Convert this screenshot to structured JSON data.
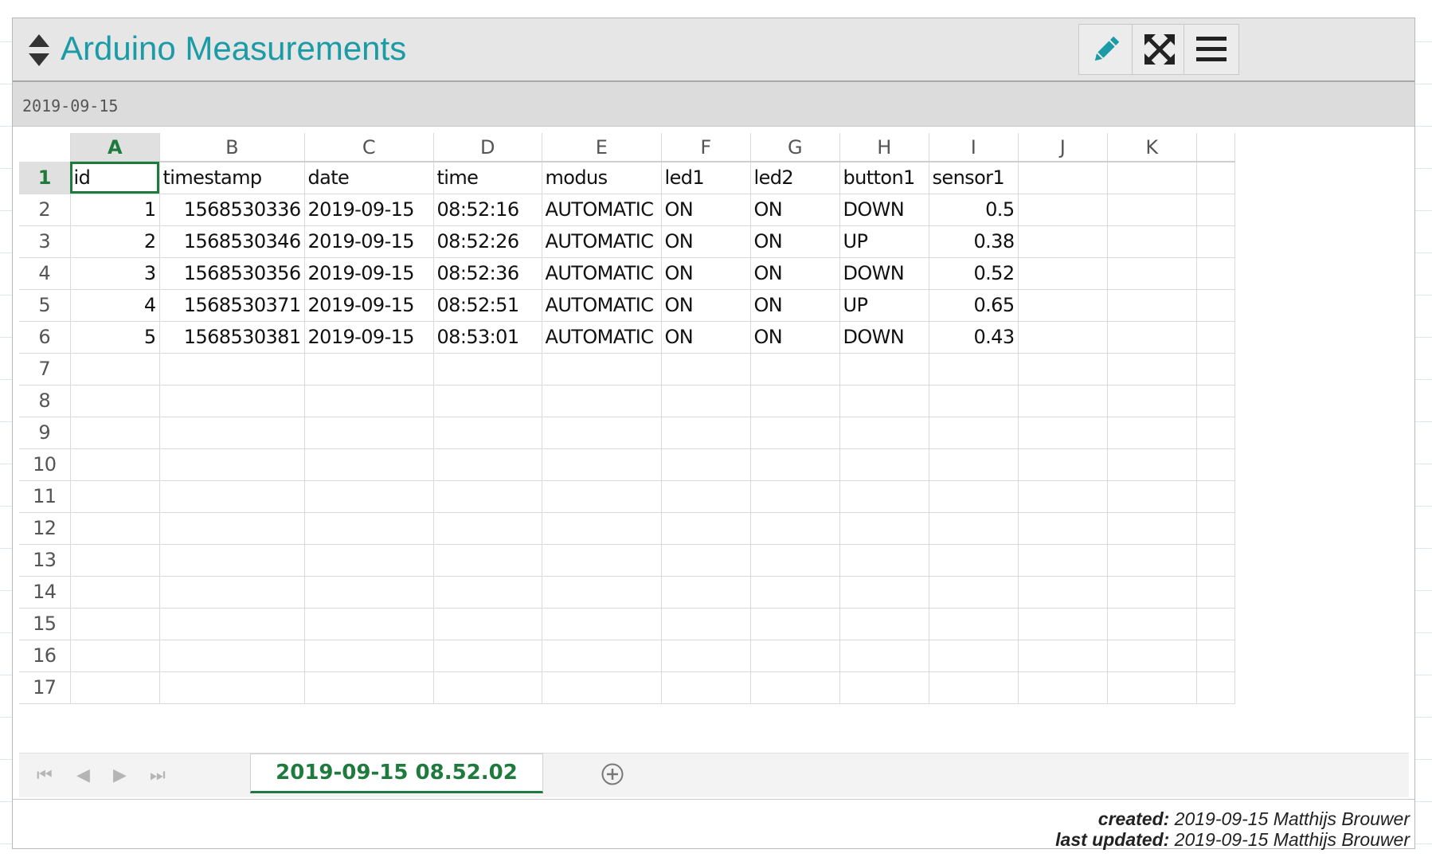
{
  "tiddler": {
    "title": "Arduino Measurements",
    "subtitle": "2019-09-15",
    "buttons": [
      "edit",
      "fullscreen",
      "more"
    ]
  },
  "spreadsheet": {
    "columns": [
      "A",
      "B",
      "C",
      "D",
      "E",
      "F",
      "G",
      "H",
      "I",
      "J",
      "K"
    ],
    "active_column": "A",
    "active_row": 1,
    "header_row": [
      "id",
      "timestamp",
      "date",
      "time",
      "modus",
      "led1",
      "led2",
      "button1",
      "sensor1"
    ],
    "rows": [
      [
        "1",
        "1568530336",
        "2019-09-15",
        "08:52:16",
        "AUTOMATIC",
        "ON",
        "ON",
        "DOWN",
        "0.5"
      ],
      [
        "2",
        "1568530346",
        "2019-09-15",
        "08:52:26",
        "AUTOMATIC",
        "ON",
        "ON",
        "UP",
        "0.38"
      ],
      [
        "3",
        "1568530356",
        "2019-09-15",
        "08:52:36",
        "AUTOMATIC",
        "ON",
        "ON",
        "DOWN",
        "0.52"
      ],
      [
        "4",
        "1568530371",
        "2019-09-15",
        "08:52:51",
        "AUTOMATIC",
        "ON",
        "ON",
        "UP",
        "0.65"
      ],
      [
        "5",
        "1568530381",
        "2019-09-15",
        "08:53:01",
        "AUTOMATIC",
        "ON",
        "ON",
        "DOWN",
        "0.43"
      ]
    ],
    "row_numbers": [
      "1",
      "2",
      "3",
      "4",
      "5",
      "6",
      "7",
      "8",
      "9",
      "10",
      "11",
      "12",
      "13",
      "14",
      "15",
      "16",
      "17"
    ],
    "sheet_tab": "2019-09-15 08.52.02"
  },
  "footer": {
    "created_label": "created:",
    "created_value": "2019-09-15 Matthijs Brouwer",
    "updated_label": "last updated:",
    "updated_value": "2019-09-15 Matthijs Brouwer"
  },
  "colors": {
    "title": "#1a9ba6",
    "accent_green": "#1f7a3e",
    "titlebar_bg": "#e6e6e6"
  }
}
